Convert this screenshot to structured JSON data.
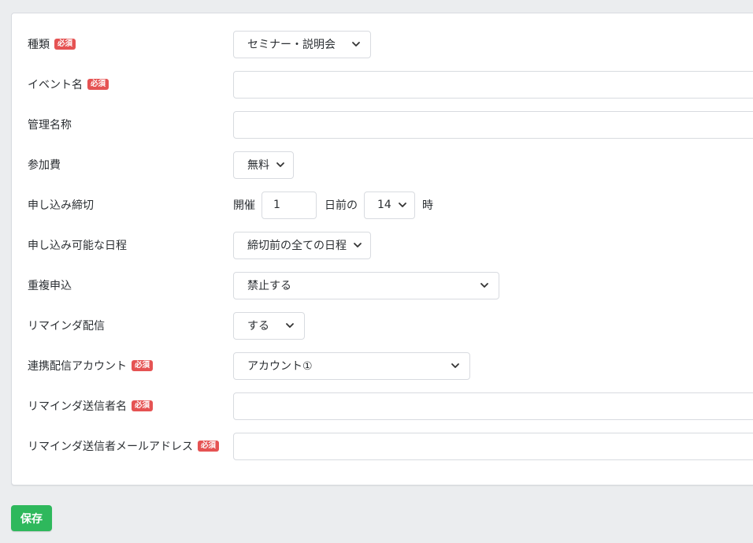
{
  "required_badge": "必須",
  "form": {
    "type": {
      "label": "種類",
      "value": "セミナー・説明会"
    },
    "event_name": {
      "label": "イベント名",
      "value": ""
    },
    "admin_name": {
      "label": "管理名称",
      "value": ""
    },
    "fee": {
      "label": "参加費",
      "value": "無料"
    },
    "deadline": {
      "label": "申し込み締切",
      "prefix": "開催",
      "days_value": "1",
      "days_suffix": "日前の",
      "hour_value": "14",
      "hour_suffix": "時"
    },
    "available_dates": {
      "label": "申し込み可能な日程",
      "value": "締切前の全ての日程"
    },
    "duplicate": {
      "label": "重複申込",
      "value": "禁止する"
    },
    "reminder": {
      "label": "リマインダ配信",
      "value": "する"
    },
    "linked_account": {
      "label": "連携配信アカウント",
      "value": "アカウント①"
    },
    "reminder_sender_name": {
      "label": "リマインダ送信者名",
      "value": ""
    },
    "reminder_sender_email": {
      "label": "リマインダ送信者メールアドレス",
      "value": ""
    }
  },
  "save_label": "保存",
  "colors": {
    "background": "#ebedef",
    "card": "#ffffff",
    "required": "#e55353",
    "save": "#2eb85c",
    "border": "#d8dbe0"
  }
}
